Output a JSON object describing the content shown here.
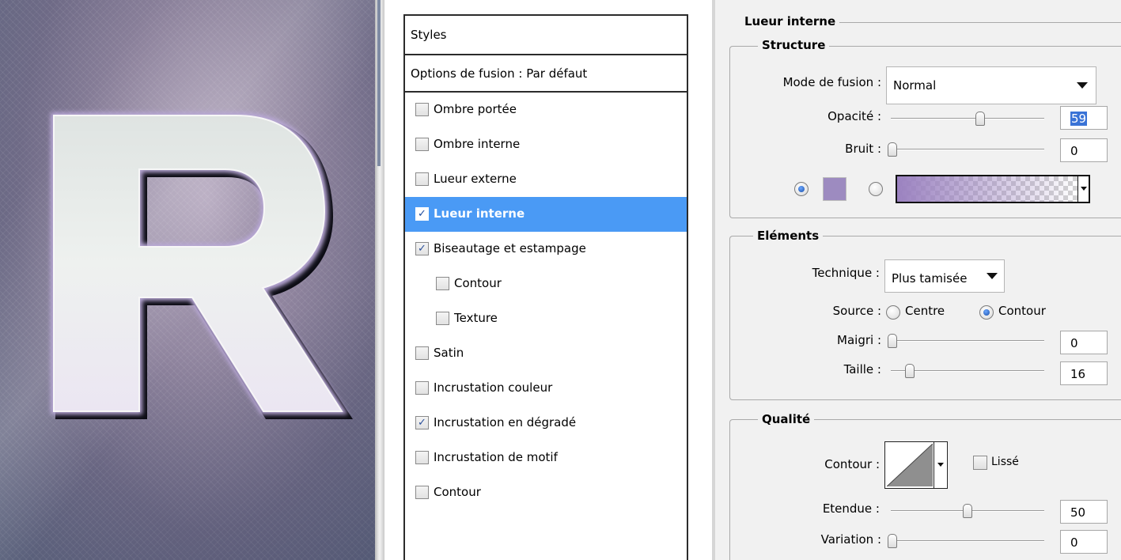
{
  "preview": {
    "letter": "R"
  },
  "styles_panel": {
    "header": "Styles",
    "blend_options": "Options de fusion : Par défaut",
    "items": [
      {
        "label": "Ombre portée",
        "checked": false,
        "indent": false,
        "selected": false
      },
      {
        "label": "Ombre interne",
        "checked": false,
        "indent": false,
        "selected": false
      },
      {
        "label": "Lueur externe",
        "checked": false,
        "indent": false,
        "selected": false
      },
      {
        "label": "Lueur interne",
        "checked": true,
        "indent": false,
        "selected": true
      },
      {
        "label": "Biseautage et estampage",
        "checked": true,
        "indent": false,
        "selected": false
      },
      {
        "label": "Contour",
        "checked": false,
        "indent": true,
        "selected": false
      },
      {
        "label": "Texture",
        "checked": false,
        "indent": true,
        "selected": false
      },
      {
        "label": "Satin",
        "checked": false,
        "indent": false,
        "selected": false
      },
      {
        "label": "Incrustation couleur",
        "checked": false,
        "indent": false,
        "selected": false
      },
      {
        "label": "Incrustation en dégradé",
        "checked": true,
        "indent": false,
        "selected": false
      },
      {
        "label": "Incrustation de motif",
        "checked": false,
        "indent": false,
        "selected": false
      },
      {
        "label": "Contour",
        "checked": false,
        "indent": false,
        "selected": false
      }
    ]
  },
  "settings": {
    "title": "Lueur interne",
    "structure": {
      "title": "Structure",
      "blend_mode_label": "Mode de fusion :",
      "blend_mode_value": "Normal",
      "opacity_label": "Opacité :",
      "opacity_value": "59",
      "opacity_fraction": 0.59,
      "noise_label": "Bruit :",
      "noise_value": "0",
      "noise_fraction": 0.0,
      "color_radio_selected": "color",
      "glow_color": "#9d8bc0"
    },
    "elements": {
      "title": "Eléments",
      "technique_label": "Technique :",
      "technique_value": "Plus tamisée",
      "source_label": "Source :",
      "source_center": "Centre",
      "source_edge": "Contour",
      "source_selected": "edge",
      "choke_label": "Maigri :",
      "choke_value": "0",
      "choke_fraction": 0.0,
      "size_label": "Taille :",
      "size_value": "16",
      "size_fraction": 0.1
    },
    "quality": {
      "title": "Qualité",
      "contour_label": "Contour :",
      "antialias_label": "Lissé",
      "antialias_checked": false,
      "range_label": "Etendue :",
      "range_value": "50",
      "range_fraction": 0.5,
      "jitter_label": "Variation :",
      "jitter_value": "0",
      "jitter_fraction": 0.0
    }
  },
  "colors": {
    "selection": "#4a9af5",
    "glow": "#9d8bc0"
  }
}
